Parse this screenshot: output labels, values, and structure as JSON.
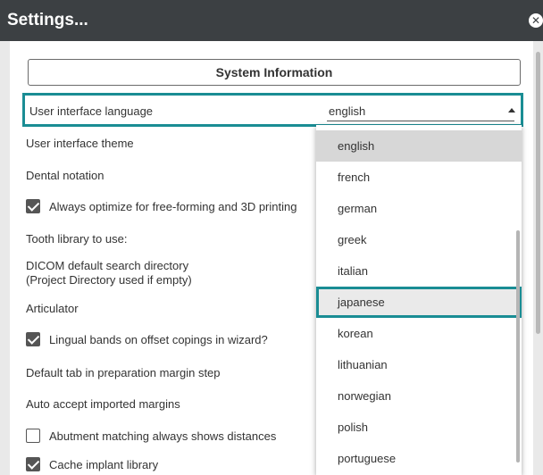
{
  "window": {
    "title": "Settings..."
  },
  "system_info_button": "System Information",
  "language": {
    "label": "User interface language",
    "value": "english"
  },
  "settings_rows": [
    "User interface theme",
    "Dental notation",
    "Tooth library to use:",
    "DICOM default search directory",
    "(Project Directory used if empty)",
    "Articulator",
    "Default tab in preparation margin step",
    "Auto accept imported margins"
  ],
  "checkboxes": [
    {
      "label": "Always optimize for free-forming and 3D printing",
      "checked": true
    },
    {
      "label": "Lingual bands on offset copings in wizard?",
      "checked": true
    },
    {
      "label": "Abutment matching always shows distances",
      "checked": false
    },
    {
      "label": "Cache implant library",
      "checked": true
    }
  ],
  "language_options": [
    "english",
    "french",
    "german",
    "greek",
    "italian",
    "japanese",
    "korean",
    "lithuanian",
    "norwegian",
    "polish",
    "portuguese"
  ],
  "selected_option": "english",
  "highlighted_option": "japanese",
  "colors": {
    "titlebar": "#3c4043",
    "highlight": "#1a8d94"
  }
}
